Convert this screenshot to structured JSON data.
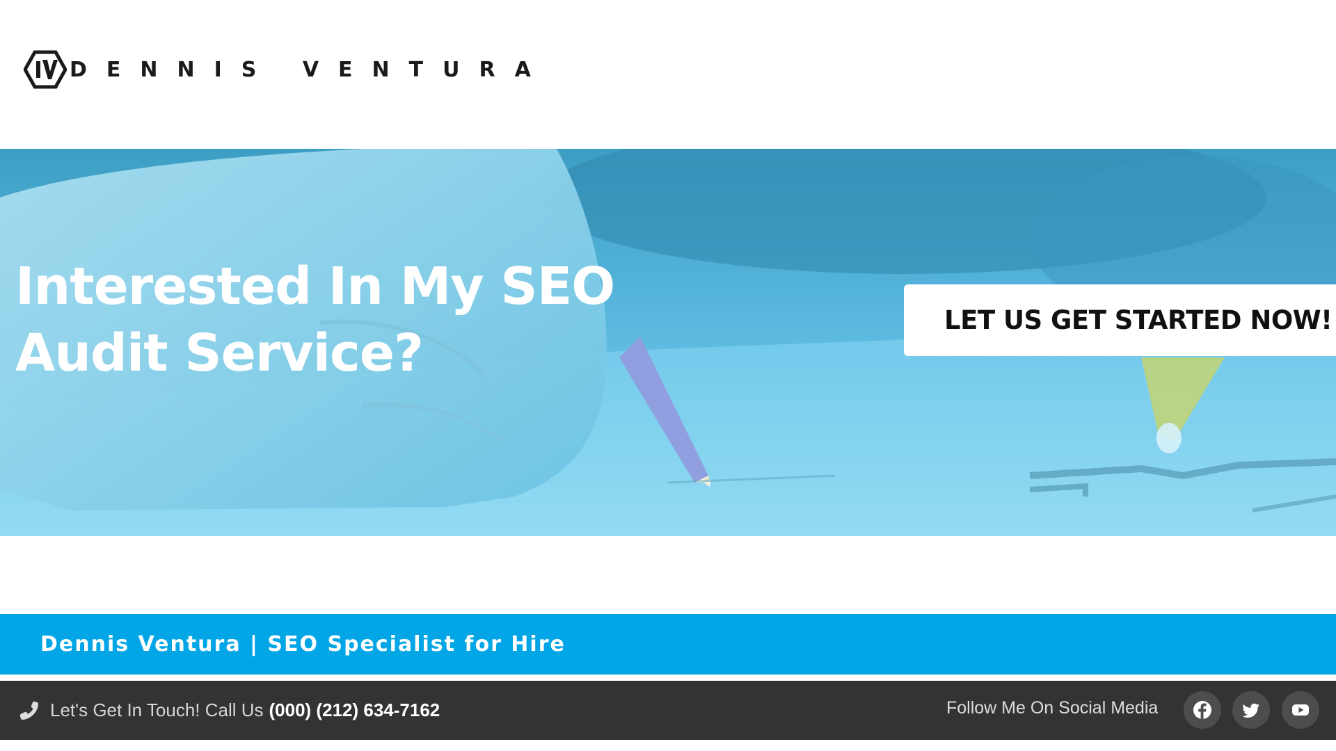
{
  "header": {
    "logo_text": "DENNIS VENTURA",
    "logo_icon": "dv-hexagon-logo"
  },
  "hero": {
    "title": "Interested In My SEO Audit Service?",
    "cta_label": "LET US GET STARTED NOW!",
    "background": "hand-writing-with-pencil-photo",
    "overlay_color": "#5bc8ec"
  },
  "tagline_bar": {
    "text": "Dennis Ventura | SEO Specialist for Hire",
    "color": "#02a6e6"
  },
  "footer": {
    "contact_lead": "Let's Get In Touch! Call Us",
    "phone": "(000) (212) 634-7162",
    "phone_icon": "phone-icon",
    "follow_text": "Follow Me On Social Media",
    "social": [
      {
        "name": "facebook",
        "icon": "facebook-icon"
      },
      {
        "name": "twitter",
        "icon": "twitter-icon"
      },
      {
        "name": "youtube",
        "icon": "youtube-icon"
      }
    ],
    "background": "#333333"
  }
}
